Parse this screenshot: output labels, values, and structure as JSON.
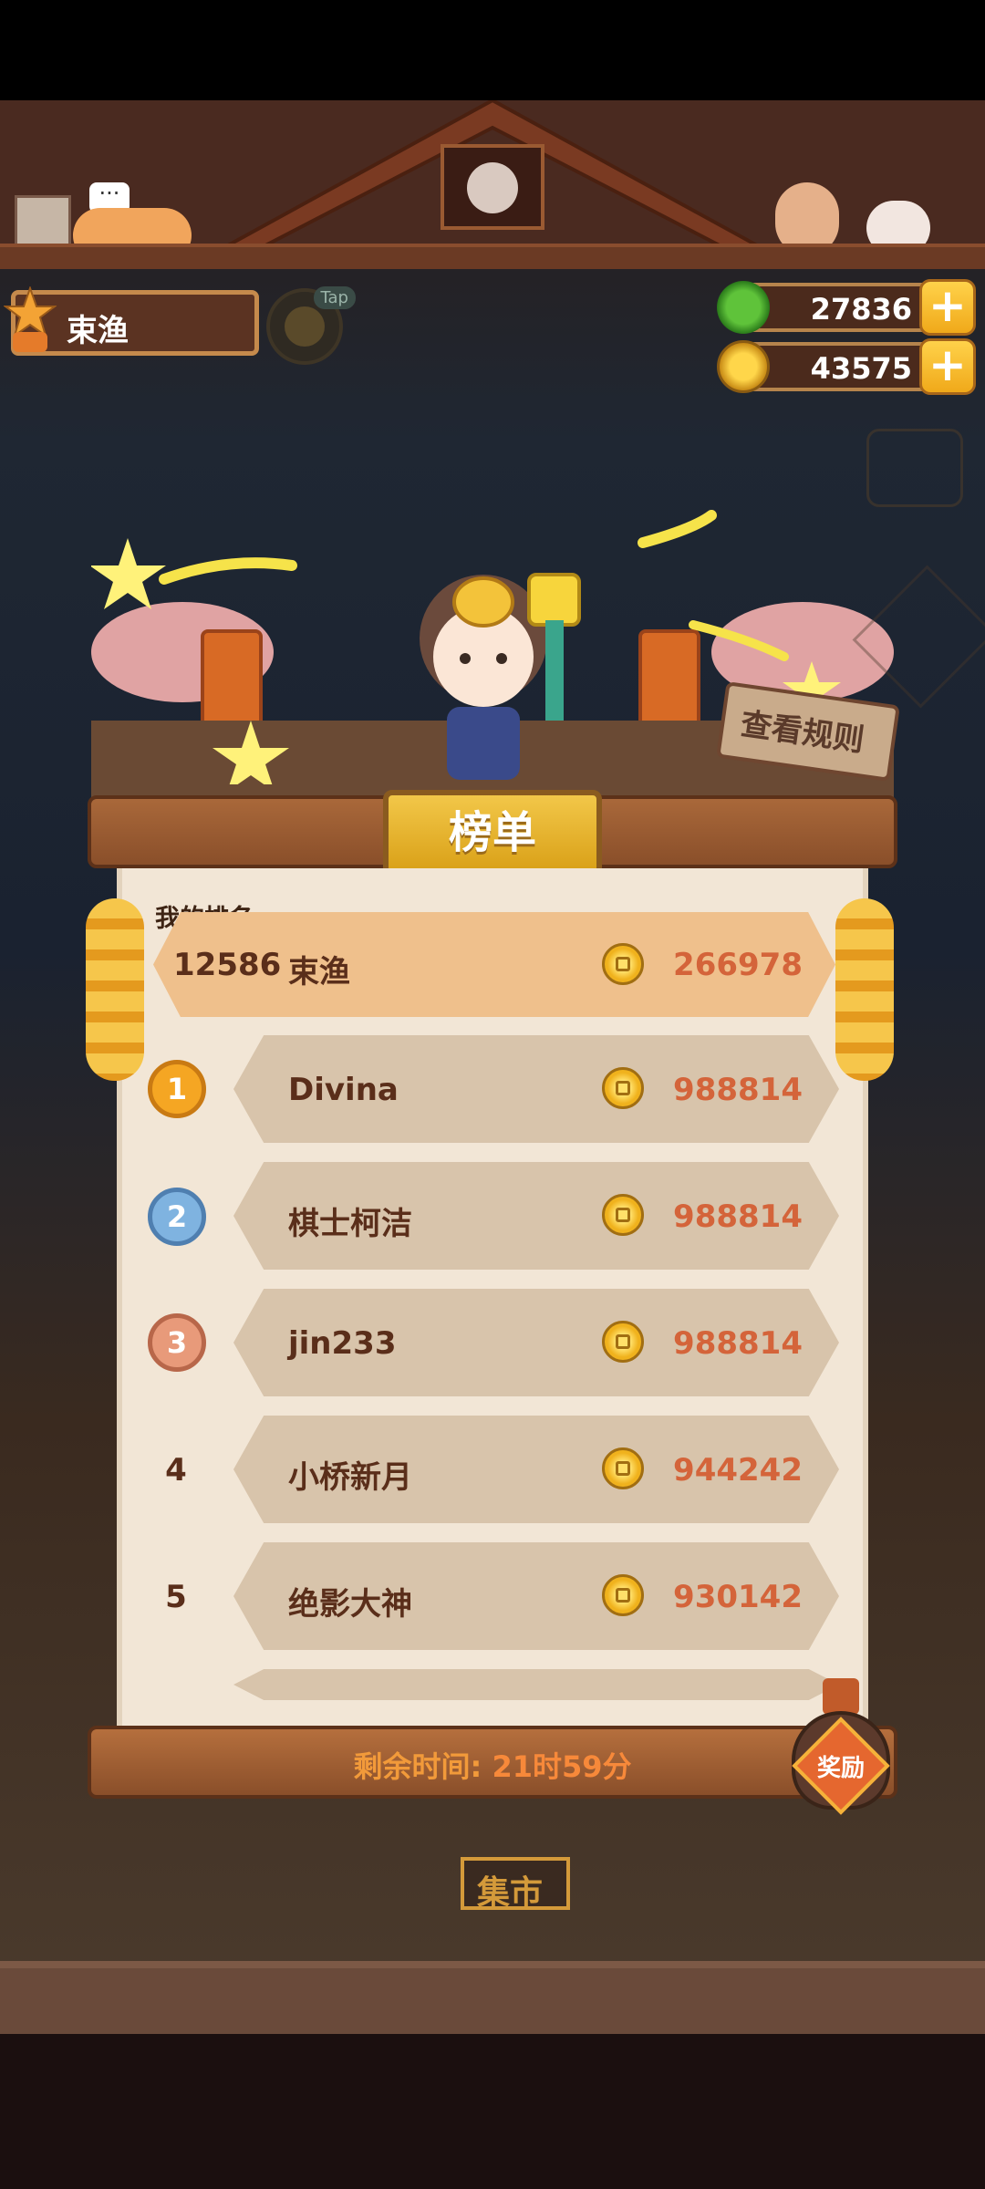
{
  "player": {
    "name": "束渔"
  },
  "header": {
    "tap_tag": "Tap"
  },
  "currency": {
    "green": "27836",
    "coin": "43575",
    "plus": "+"
  },
  "hero": {
    "rules_button": "查看规则"
  },
  "board": {
    "title": "榜单",
    "my_rank_label": "我的排名",
    "my_rank": {
      "rank": "12586",
      "name": "束渔",
      "score": "266978"
    },
    "entries": [
      {
        "rank": "1",
        "name": "Divina",
        "score": "988814"
      },
      {
        "rank": "2",
        "name": "棋士柯洁",
        "score": "988814"
      },
      {
        "rank": "3",
        "name": "jin233",
        "score": "988814"
      },
      {
        "rank": "4",
        "name": "小桥新月",
        "score": "944242"
      },
      {
        "rank": "5",
        "name": "绝影大神",
        "score": "930142"
      }
    ],
    "timer_label": "剩余时间: ",
    "timer_value": "21时59分",
    "reward_button": "奖励"
  },
  "background": {
    "market_sign": "集市"
  },
  "colors": {
    "accent_gold": "#f2c749",
    "score": "#d4643a",
    "medal_gold": "#f5a623",
    "medal_silver": "#7fb3e0",
    "medal_bronze": "#e89a7a"
  },
  "icons": [
    "gift-icon",
    "chat-bubble-icon",
    "green-gem-icon",
    "coin-icon",
    "plus-icon",
    "medal-icon",
    "jar-icon"
  ]
}
